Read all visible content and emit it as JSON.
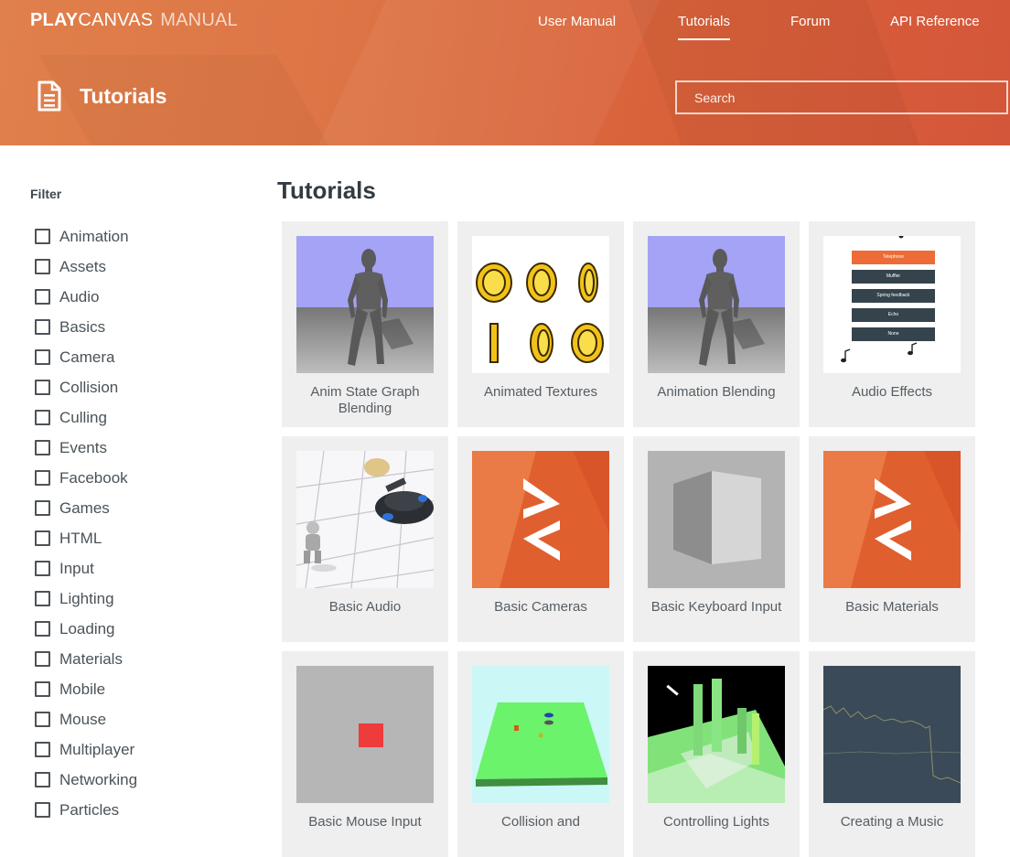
{
  "brand": {
    "play": "PLAY",
    "canvas": "CANVAS",
    "manual": "MANUAL"
  },
  "nav": [
    {
      "label": "User Manual",
      "active": false
    },
    {
      "label": "Tutorials",
      "active": true
    },
    {
      "label": "Forum",
      "active": false
    },
    {
      "label": "API Reference",
      "active": false
    }
  ],
  "header": {
    "title": "Tutorials",
    "icon": "document-icon"
  },
  "search": {
    "placeholder": "Search"
  },
  "sidebar": {
    "title": "Filter",
    "filters": [
      "Animation",
      "Assets",
      "Audio",
      "Basics",
      "Camera",
      "Collision",
      "Culling",
      "Events",
      "Facebook",
      "Games",
      "HTML",
      "Input",
      "Lighting",
      "Loading",
      "Materials",
      "Mobile",
      "Mouse",
      "Multiplayer",
      "Networking",
      "Particles"
    ]
  },
  "main": {
    "title": "Tutorials",
    "cards": [
      {
        "title": "Anim State Graph Blending",
        "thumb": "robot-figure"
      },
      {
        "title": "Animated Textures",
        "thumb": "coins"
      },
      {
        "title": "Animation Blending",
        "thumb": "robot-figure"
      },
      {
        "title": "Audio Effects",
        "thumb": "audio-menu",
        "menu": [
          "Telephone",
          "Muffler",
          "Spring feedback",
          "Echo",
          "None"
        ]
      },
      {
        "title": "Basic Audio",
        "thumb": "tank-scene"
      },
      {
        "title": "Basic Cameras",
        "thumb": "playcanvas-logo"
      },
      {
        "title": "Basic Keyboard Input",
        "thumb": "grey-cube"
      },
      {
        "title": "Basic Materials",
        "thumb": "playcanvas-logo"
      },
      {
        "title": "Basic Mouse Input",
        "thumb": "red-square"
      },
      {
        "title": "Collision and",
        "thumb": "green-platform"
      },
      {
        "title": "Controlling Lights",
        "thumb": "lit-pillars"
      },
      {
        "title": "Creating a Music",
        "thumb": "waveform"
      }
    ]
  },
  "colors": {
    "header_start": "#e0804c",
    "header_end": "#d4563a",
    "accent": "#e8703a",
    "card_bg": "#efefef"
  }
}
